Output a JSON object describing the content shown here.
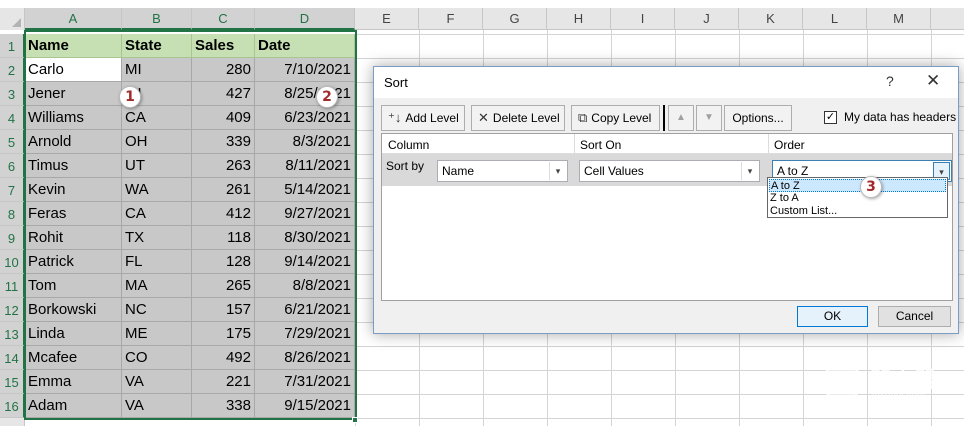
{
  "sheet": {
    "columns": [
      "A",
      "B",
      "C",
      "D",
      "E",
      "F",
      "G",
      "H",
      "I",
      "J",
      "K",
      "L",
      "M"
    ],
    "row_numbers": [
      "1",
      "2",
      "3",
      "4",
      "5",
      "6",
      "7",
      "8",
      "9",
      "10",
      "11",
      "12",
      "13",
      "14",
      "15",
      "16"
    ],
    "headers": [
      "Name",
      "State",
      "Sales",
      "Date"
    ],
    "rows": [
      [
        "Carlo",
        "MI",
        "280",
        "7/10/2021"
      ],
      [
        "Jener",
        "MI",
        "427",
        "8/25/2021"
      ],
      [
        "Williams",
        "CA",
        "409",
        "6/23/2021"
      ],
      [
        "Arnold",
        "OH",
        "339",
        "8/3/2021"
      ],
      [
        "Timus",
        "UT",
        "263",
        "8/11/2021"
      ],
      [
        "Kevin",
        "WA",
        "261",
        "5/14/2021"
      ],
      [
        "Feras",
        "CA",
        "412",
        "9/27/2021"
      ],
      [
        "Rohit",
        "TX",
        "118",
        "8/30/2021"
      ],
      [
        "Patrick",
        "FL",
        "128",
        "9/14/2021"
      ],
      [
        "Tom",
        "MA",
        "265",
        "8/8/2021"
      ],
      [
        "Borkowski",
        "NC",
        "157",
        "6/21/2021"
      ],
      [
        "Linda",
        "ME",
        "175",
        "7/29/2021"
      ],
      [
        "Mcafee",
        "CO",
        "492",
        "8/26/2021"
      ],
      [
        "Emma",
        "VA",
        "221",
        "7/31/2021"
      ],
      [
        "Adam",
        "VA",
        "338",
        "9/15/2021"
      ]
    ],
    "colors": {
      "header_fill": "#c6e0b4",
      "selection_fill": "#c8c8c8",
      "selection_border": "#217346"
    }
  },
  "dialog": {
    "title": "Sort",
    "help": "?",
    "close": "✕",
    "toolbar": {
      "add_level": "Add Level",
      "delete_level": "Delete Level",
      "copy_level": "Copy Level",
      "move_up": "▲",
      "move_down": "▼",
      "options": "Options...",
      "headers_checkbox": "My data has headers",
      "headers_checked": true
    },
    "column_headers": {
      "column": "Column",
      "sort_on": "Sort On",
      "order": "Order"
    },
    "level": {
      "label": "Sort by",
      "column_value": "Name",
      "sort_on_value": "Cell Values",
      "order_value": "A to Z"
    },
    "order_options": [
      "A to Z",
      "Z to A",
      "Custom List..."
    ],
    "badges": [
      "1",
      "2",
      "3"
    ],
    "ok": "OK",
    "cancel": "Cancel"
  },
  "watermark": {
    "chinese": "路由器",
    "url": "luyouqi.com"
  },
  "icons": [
    "add-level-icon",
    "delete-level-icon",
    "copy-level-icon",
    "move-up-icon",
    "move-down-icon",
    "chevron-down-icon",
    "checkmark-icon",
    "close-icon",
    "help-icon",
    "router-logo-icon"
  ]
}
